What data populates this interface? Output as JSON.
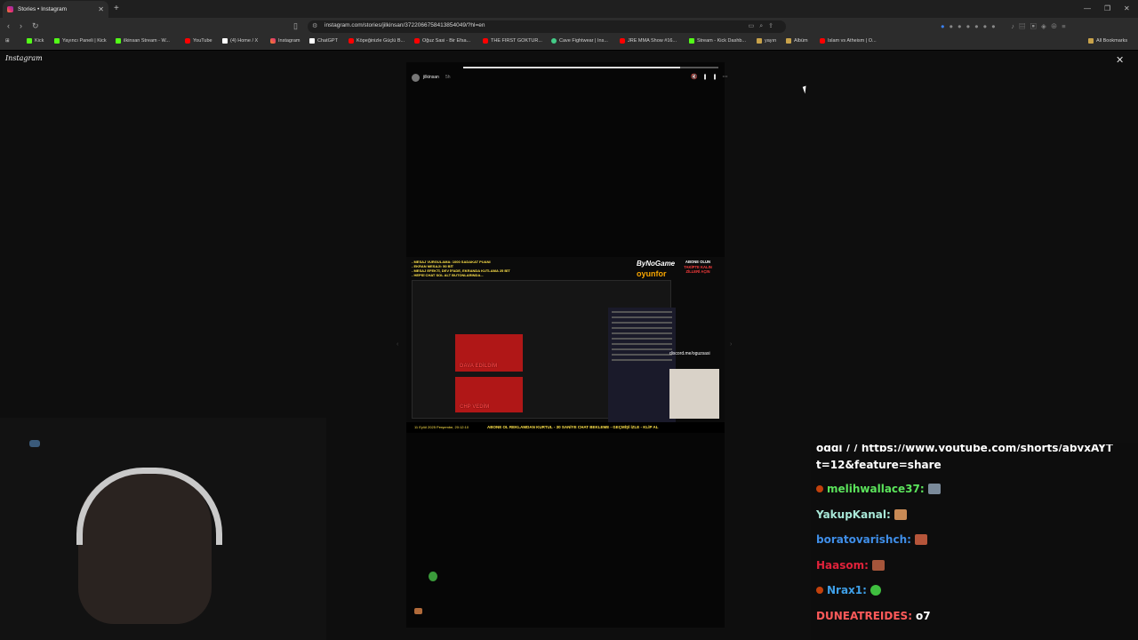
{
  "browser": {
    "tab_title": "Stories • Instagram",
    "url": "instagram.com/stories/jilkinsan/3722066758413854049/?hl=en",
    "all_bookmarks": "All Bookmarks"
  },
  "bookmarks": [
    {
      "label": "Kick",
      "icon": "kick"
    },
    {
      "label": "Yayıncı Paneli | Kick",
      "icon": "kick"
    },
    {
      "label": "ilkinsan Stream - W...",
      "icon": "kick"
    },
    {
      "label": "YouTube",
      "icon": "youtube"
    },
    {
      "label": "(4) Home / X",
      "icon": "x"
    },
    {
      "label": "Instagram",
      "icon": "instagram"
    },
    {
      "label": "ChatGPT",
      "icon": "chatgpt"
    },
    {
      "label": "Köpeğinizle Güçlü B...",
      "icon": "youtube"
    },
    {
      "label": "Oğuz Sasi - Bir Efsa...",
      "icon": "youtube"
    },
    {
      "label": "THE FIRST GOKTUR...",
      "icon": "youtube"
    },
    {
      "label": "Cave Fightwear | Ins...",
      "icon": "cave"
    },
    {
      "label": "JRE MMA Show #16...",
      "icon": "youtube"
    },
    {
      "label": "Stream - Kick Dashb...",
      "icon": "kick"
    },
    {
      "label": "yayın",
      "icon": "folder"
    },
    {
      "label": "Albüm",
      "icon": "folder"
    },
    {
      "label": "Islam vs Atheism | O...",
      "icon": "youtube"
    }
  ],
  "instagram": {
    "logo": "Instagram",
    "story": {
      "username": "jilkinsan",
      "time": "5h",
      "progress": 0.85
    }
  },
  "stream": {
    "lines": [
      "- MESAJ VURGULAMA: 1000 SADAKAT PUANI",
      "- EKRAN MESAJI: 50 BİT",
      "- MESAJ EFEKTİ, DEV İFADE, EKRANDA KUTLAMA 25 BİT",
      "- HEPSİ CHAT SOL ALT BUTONLARINDA..."
    ],
    "brand": "ByNoGame",
    "brand2": "oyunfor",
    "subscribe_top": "ABONE OLUN",
    "subscribe_mid": "TAKİPTE KALIN",
    "subscribe_low": "ZİLLERİ AÇIN",
    "thumb1": "DAVA EDİLDİM",
    "thumb2": "CHP VEDİM",
    "discord": "discord.me/oguzsasi",
    "date": "11 Eylül 2025 Perşembe, 20:12:10",
    "bottom": "ABONE OL REKLAMDAN KURTUL - 30 SANİYE CHAT BEKLEME - GEÇMİŞİ İZLE - KLİP AL"
  },
  "chat": {
    "partial_top": "oggi / / https://www.youtube.com/shorts/abyxAYT",
    "partial_cont": "t=12&feature=share",
    "messages": [
      {
        "user": "melihwallace37:",
        "color": "#5be35b",
        "badge": true,
        "emote": "#7a8a9a",
        "text": ""
      },
      {
        "user": "YakupKanal:",
        "color": "#a8e8d8",
        "badge": false,
        "emote": "#c98a55",
        "text": ""
      },
      {
        "user": "boratovarishch:",
        "color": "#3f8ee8",
        "badge": false,
        "emote": "#b5553a",
        "text": ""
      },
      {
        "user": "Haasom:",
        "color": "#e0223a",
        "badge": false,
        "emote": "#a5553a",
        "text": ""
      },
      {
        "user": "Nrax1:",
        "color": "#3fa0e8",
        "badge": true,
        "emote": "green",
        "text": ""
      },
      {
        "user": "DUNEATREIDES:",
        "color": "#ff5a5a",
        "badge": false,
        "emote": "",
        "text": "o7"
      }
    ]
  }
}
